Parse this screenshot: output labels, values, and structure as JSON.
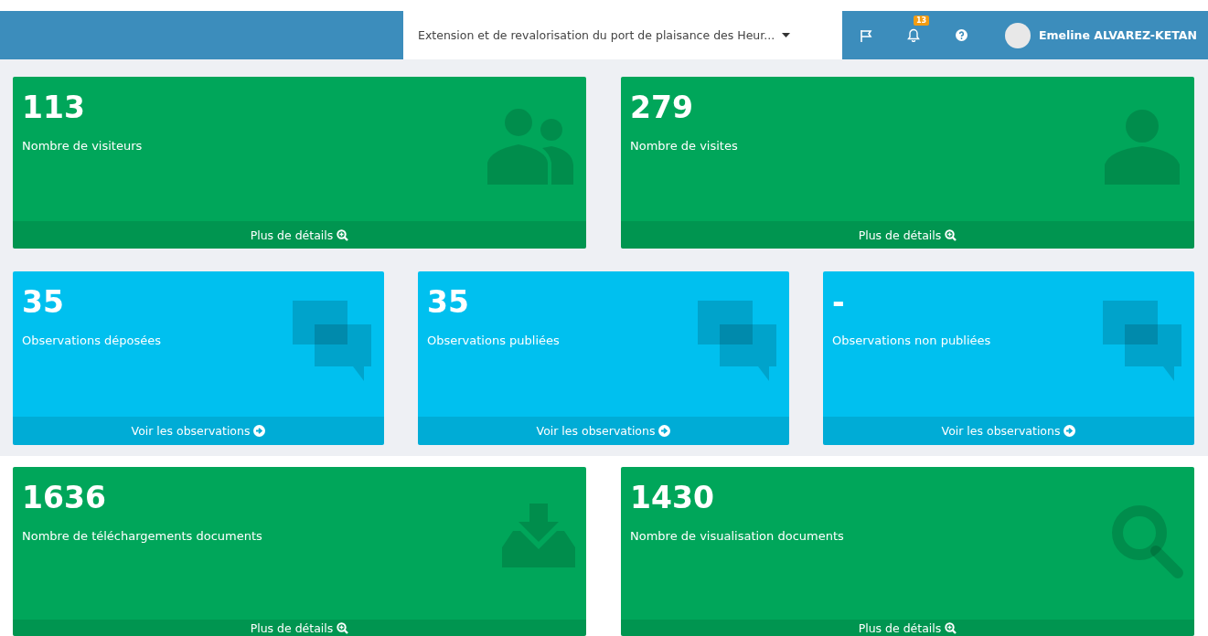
{
  "header": {
    "project_select": {
      "value": "Extension et de revalorisation du port de plaisance des Heur..."
    },
    "notifications_badge": "13",
    "user_name": "Emeline ALVAREZ-KETAN"
  },
  "rows": [
    {
      "cards": [
        {
          "kind": "users",
          "color": "#00a65a",
          "value": "113",
          "label": "Nombre de visiteurs",
          "link": {
            "text": "Plus de détails",
            "kind": "zoom"
          }
        },
        {
          "kind": "user",
          "color": "#00a65a",
          "value": "279",
          "label": "Nombre de visites",
          "link": {
            "text": "Plus de détails",
            "kind": "zoom"
          }
        }
      ]
    },
    {
      "cards": [
        {
          "kind": "comments",
          "color": "#00c0ef",
          "value": "35",
          "label": "Observations déposées",
          "link": {
            "text": "Voir les observations",
            "kind": "arrow"
          }
        },
        {
          "kind": "comments",
          "color": "#00c0ef",
          "value": "35",
          "label": "Observations publiées",
          "link": {
            "text": "Voir les observations",
            "kind": "arrow"
          }
        },
        {
          "kind": "comments",
          "color": "#00c0ef",
          "value": "-",
          "label": "Observations non publiées",
          "link": {
            "text": "Voir les observations",
            "kind": "arrow"
          }
        }
      ]
    },
    {
      "cards": [
        {
          "kind": "download",
          "color": "#00a65a",
          "value": "1636",
          "label": "Nombre de téléchargements documents",
          "link": {
            "text": "Plus de détails",
            "kind": "zoom"
          }
        },
        {
          "kind": "search",
          "color": "#00a65a",
          "value": "1430",
          "label": "Nombre de visualisation documents",
          "link": {
            "text": "Plus de détails",
            "kind": "zoom"
          }
        }
      ]
    }
  ]
}
